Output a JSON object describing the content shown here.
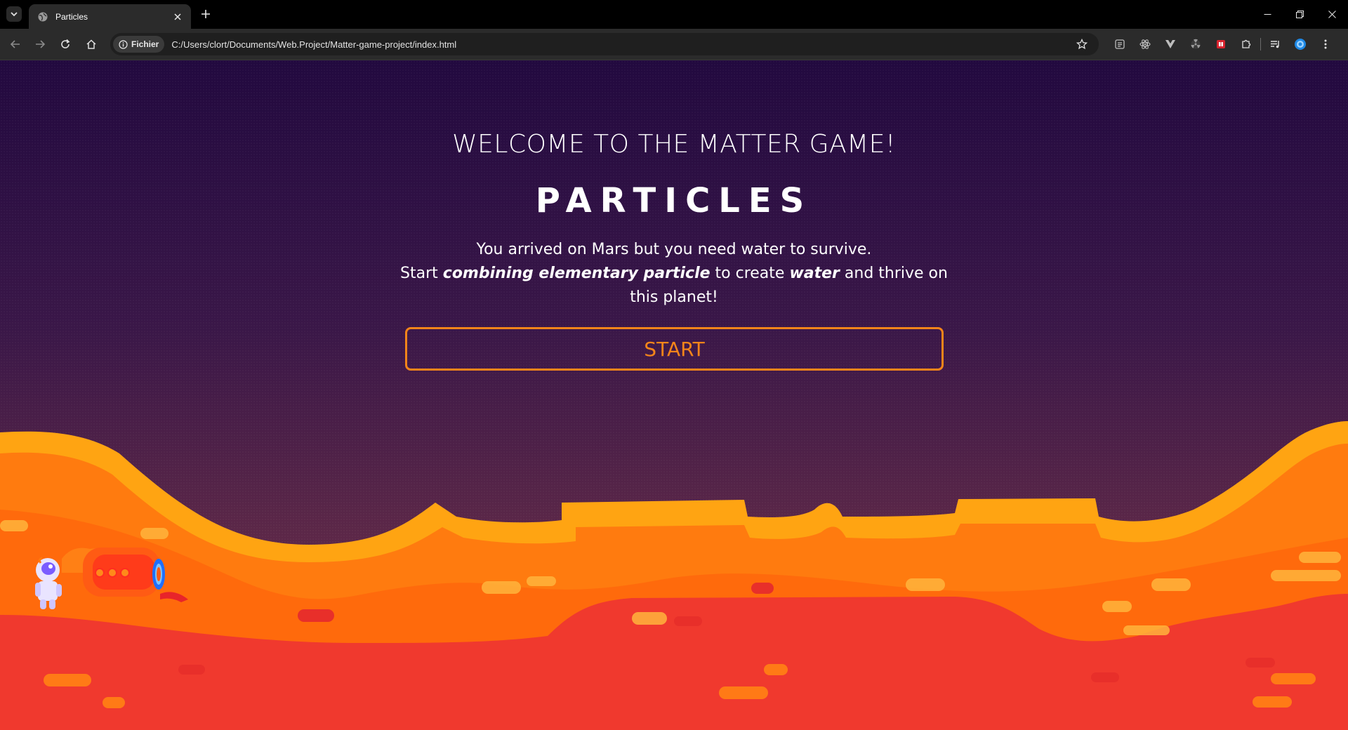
{
  "browser": {
    "tab_title": "Particles",
    "site_chip_label": "Fichier",
    "url": "C:/Users/clort/Documents/Web.Project/Matter-game-project/index.html"
  },
  "page": {
    "welcome_heading": "WELCOME TO THE MATTER GAME!",
    "game_title": "PARTICLES",
    "intro_line1": "You arrived on Mars but you need water to survive.",
    "intro_line2_start": "Start ",
    "intro_line2_em1": "combining elementary particle",
    "intro_line2_mid": " to create ",
    "intro_line2_em2": "water",
    "intro_line2_end": " and thrive on this planet!",
    "start_button": "START"
  },
  "colors": {
    "accent": "#f4851a",
    "sky_top": "#22093f",
    "sky_bottom": "#6a2c45",
    "terrain_light": "#ffa412",
    "terrain_mid": "#ff7b0f",
    "terrain_dark": "#f0392e"
  },
  "icons": {
    "tab_favicon": "globe-icon",
    "info": "info-icon",
    "bookmark": "star-icon"
  }
}
